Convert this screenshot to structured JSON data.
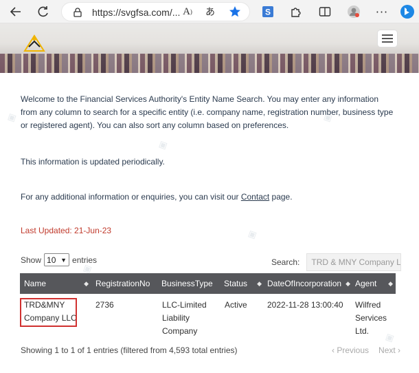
{
  "browser": {
    "url": "https://svgfsa.com/...",
    "icons": [
      "back-icon",
      "refresh-icon",
      "lock-icon",
      "read-aloud-icon",
      "translate-icon",
      "favorite-star-icon",
      "extension-s-icon",
      "puzzle-icon",
      "split-screen-icon",
      "profile-icon",
      "more-icon",
      "bing-icon"
    ]
  },
  "intro": {
    "text": "Welcome to the Financial Services Authority's Entity Name Search. You may enter any information from any column to search for a specific entity (i.e. company name, registration number, business type or registered agent). You can also sort any column based on preferences.",
    "periodic": "This information is updated periodically.",
    "contact_prefix": "For any additional information or enquiries, you can visit our ",
    "contact_link": "Contact",
    "contact_suffix": " page."
  },
  "last_updated": "Last Updated:  21-Jun-23",
  "controls": {
    "show_label": "Show",
    "show_value": "10",
    "entries_label": "entries",
    "search_label": "Search:",
    "search_value": "TRD & MNY Company LLC"
  },
  "table": {
    "headers": [
      "Name",
      "RegistrationNo",
      "BusinessType",
      "Status",
      "DateOfIncorporation",
      "Agent"
    ],
    "row": {
      "name_line1": "TRD&MNY",
      "name_line2": "Company LLC",
      "reg_no": "2736",
      "type_line1": "LLC-Limited",
      "type_line2": "Liability",
      "type_line3": "Company",
      "status": "Active",
      "date": "2022-11-28 13:00:40",
      "agent_line1": "Wilfred",
      "agent_line2": "Services",
      "agent_line3": "Ltd."
    }
  },
  "footer": {
    "info": "Showing 1 to 1 of 1 entries (filtered from 4,593 total entries)",
    "previous": "Previous",
    "next": "Next"
  },
  "colors": {
    "header_bg": "#56575b",
    "highlight": "#d0302f",
    "updated_text": "#c0392b",
    "star_blue": "#1a73e8"
  }
}
